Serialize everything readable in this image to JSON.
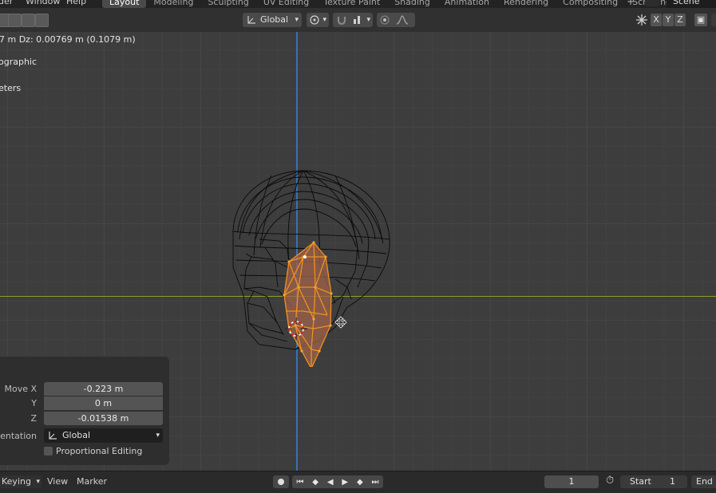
{
  "topbar": {
    "menus": [
      "der",
      "Window",
      "Help"
    ],
    "workspace_tabs": [
      "Layout",
      "Modeling",
      "Sculpting",
      "UV Editing",
      "Texture Paint",
      "Shading",
      "Animation",
      "Rendering",
      "Compositing",
      "Scripting"
    ],
    "active_tab": "Layout",
    "add_label": "+",
    "scene_name": "Scene"
  },
  "header": {
    "orientation_label": "Global",
    "axis_buttons": [
      "X",
      "Y",
      "Z"
    ]
  },
  "viewport": {
    "status_text": "7 m  Dz: 0.00769 m (0.1079 m)",
    "view_name": "ographic",
    "unit_name": "eters",
    "colors": {
      "selection": "#f0901e",
      "wire": "#0a0a0a",
      "axis_y": "#3a6fb4",
      "axis_x": "#87a02e"
    }
  },
  "operator_panel": {
    "move_x_label": "Move X",
    "move_x_value": "-0.223 m",
    "y_label": "Y",
    "y_value": "0 m",
    "z_label": "Z",
    "z_value": "-0.01538 m",
    "orientation_label": "rientation",
    "orientation_value": "Global",
    "proportional_label": "Proportional Editing"
  },
  "timeline": {
    "keying_label": "Keying",
    "view_label": "View",
    "marker_label": "Marker",
    "current_frame": "1",
    "start_label": "Start",
    "start_value": "1",
    "end_label": "End"
  }
}
